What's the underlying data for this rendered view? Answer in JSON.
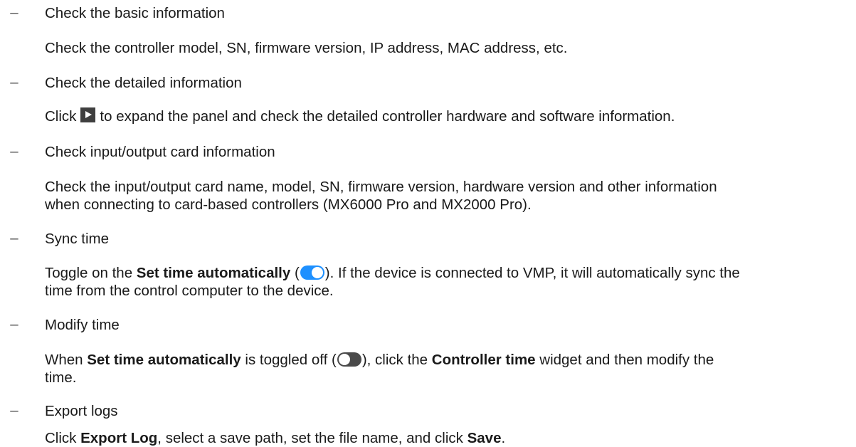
{
  "dash": "–",
  "items": [
    {
      "heading": "Check the basic information",
      "desc": "Check the controller model, SN, firmware version, IP address, MAC address, etc."
    },
    {
      "heading": "Check the detailed information",
      "desc_pre": "Click",
      "desc_icon": "expand-arrow-icon",
      "desc_post": "to expand the panel and check the detailed controller hardware and software information."
    },
    {
      "heading": "Check input/output card information",
      "desc_line1": "Check the input/output card name, model, SN, firmware version, hardware version and other information",
      "desc_line2": "when connecting to card-based controllers (MX6000 Pro and MX2000 Pro)."
    },
    {
      "heading": "Sync time",
      "desc_pre": "Toggle on the ",
      "desc_bold": "Set time automatically",
      "desc_paren_open": " (",
      "desc_icon": "toggle-on-icon",
      "desc_post_line1": "). If the device is connected to VMP, it will automatically sync the",
      "desc_line2": "time from the control computer to the device."
    },
    {
      "heading": "Modify time",
      "desc_pre": "When ",
      "desc_bold1": "Set time automatically",
      "desc_mid1": " is toggled off (",
      "desc_icon": "toggle-off-icon",
      "desc_mid2": "), click the ",
      "desc_bold2": "Controller time",
      "desc_post_line1": " widget and then modify the",
      "desc_line2": "time."
    },
    {
      "heading": "Export logs",
      "desc_pre": "Click ",
      "desc_bold1": "Export Log",
      "desc_mid": ", select a save path, set the file name, and click ",
      "desc_bold2": "Save",
      "desc_end": "."
    }
  ],
  "colors": {
    "toggle_on": "#1e90ff",
    "toggle_off": "#4a4a4a",
    "icon": "#3f3f3f"
  }
}
